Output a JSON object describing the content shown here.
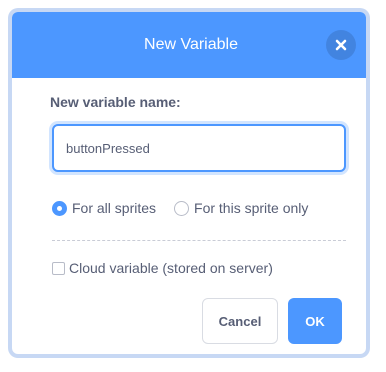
{
  "dialog": {
    "title": "New Variable",
    "close_icon": "close-icon",
    "name_label": "New variable name:",
    "name_value": "buttonPressed",
    "scope_options": [
      {
        "label": "For all sprites",
        "selected": true
      },
      {
        "label": "For this sprite only",
        "selected": false
      }
    ],
    "cloud_label": "Cloud variable (stored on server)",
    "cloud_checked": false,
    "cancel_label": "Cancel",
    "ok_label": "OK"
  },
  "colors": {
    "accent": "#4c97ff",
    "text": "#575e75"
  }
}
